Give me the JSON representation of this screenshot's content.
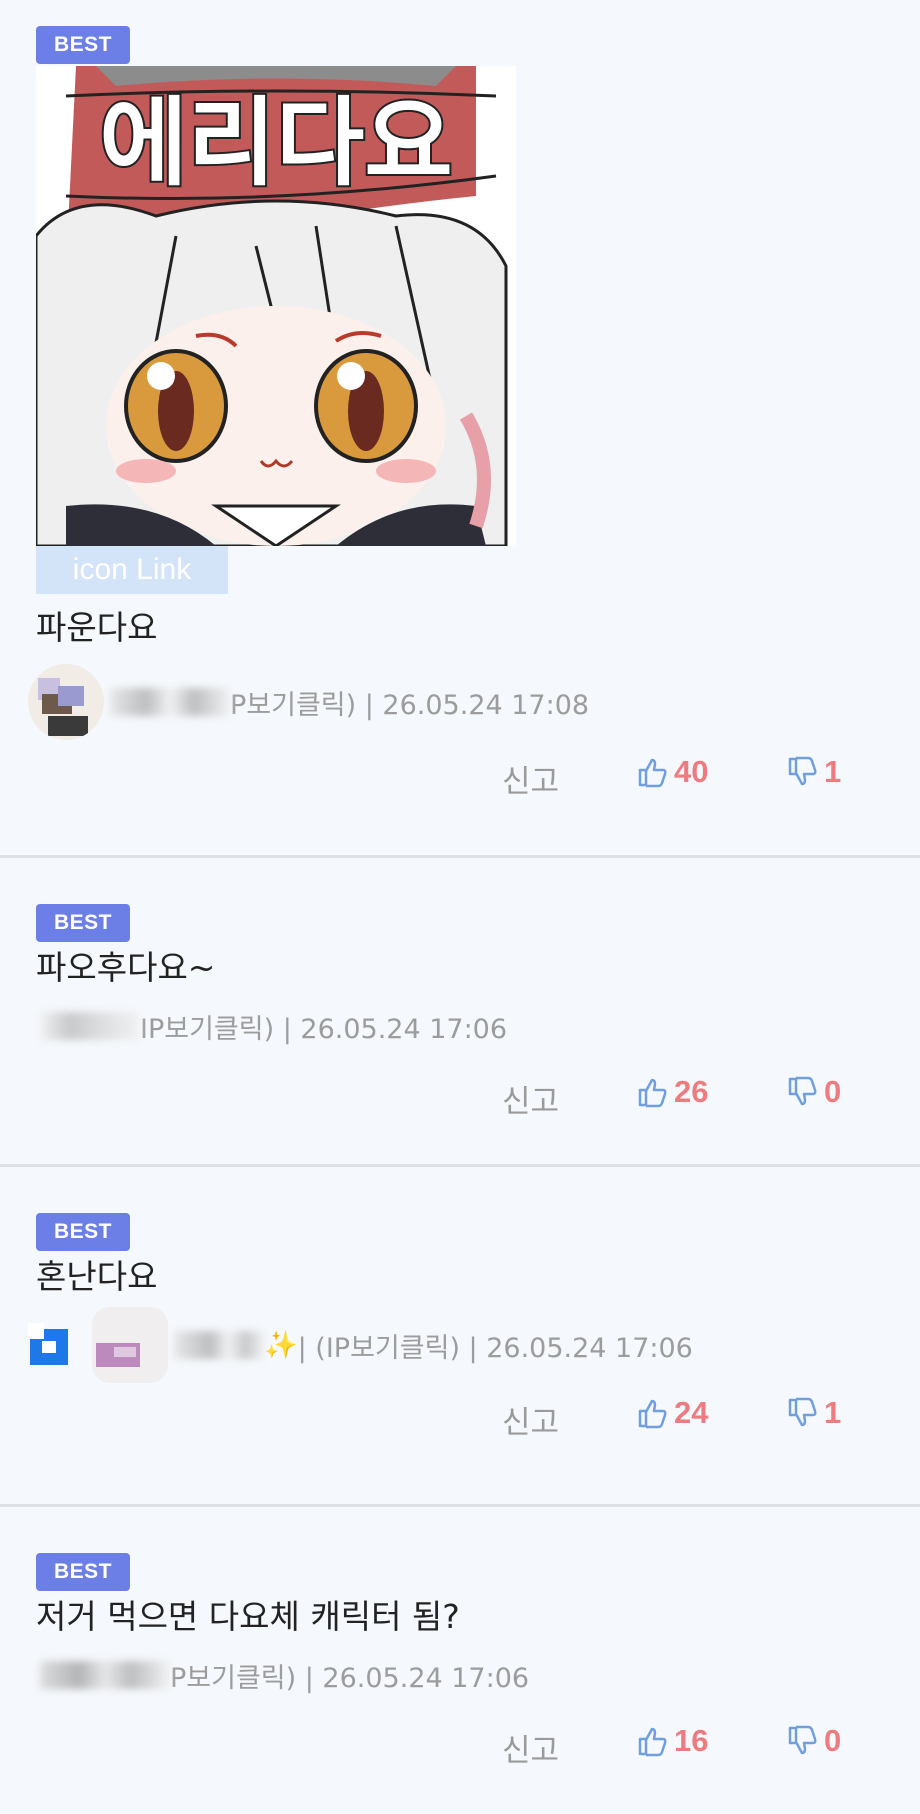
{
  "comments": [
    {
      "badge": "BEST",
      "icon_link_label": "icon Link",
      "sticker_text": "에리다요",
      "text": "파운다요",
      "meta": "P보기클릭) | 26.05.24 17:08",
      "report_label": "신고",
      "likes": "40",
      "dislikes": "1"
    },
    {
      "badge": "BEST",
      "text": "파오후다요~",
      "meta": "IP보기클릭) | 26.05.24 17:06",
      "report_label": "신고",
      "likes": "26",
      "dislikes": "0"
    },
    {
      "badge": "BEST",
      "text": "혼난다요",
      "meta_sparkle": "✨",
      "meta": " | (IP보기클릭) | 26.05.24 17:06",
      "report_label": "신고",
      "likes": "24",
      "dislikes": "1"
    },
    {
      "badge": "BEST",
      "text": "저거 먹으면 다요체 캐릭터 됨?",
      "meta": "P보기클릭) | 26.05.24 17:06",
      "report_label": "신고",
      "likes": "16",
      "dislikes": "0"
    }
  ],
  "icons": {
    "like": "thumbs-up-icon",
    "dislike": "thumbs-down-icon"
  },
  "colors": {
    "badge": "#6b7fe6",
    "count": "#ee7b80",
    "thumb": "#6f9fe0",
    "background": "#f5f8fc"
  }
}
